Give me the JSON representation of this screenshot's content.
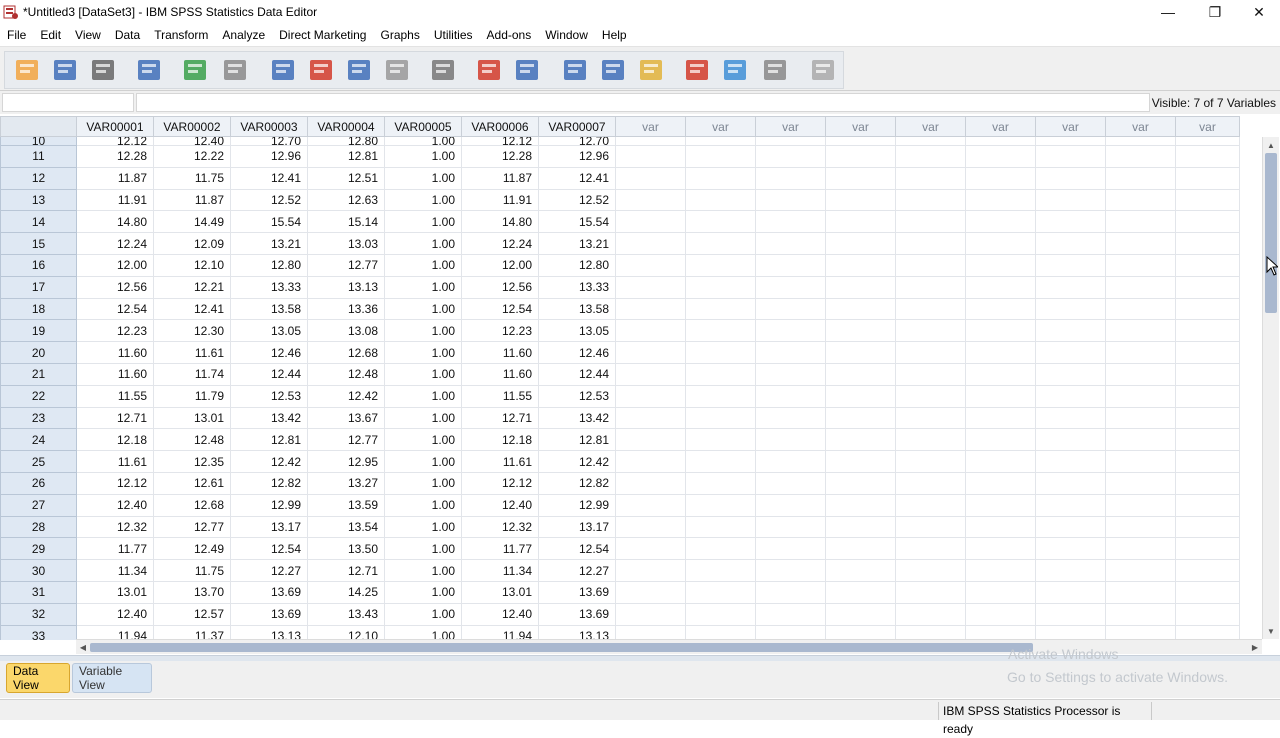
{
  "window": {
    "title": "*Untitled3 [DataSet3] - IBM SPSS Statistics Data Editor"
  },
  "menu": [
    "File",
    "Edit",
    "View",
    "Data",
    "Transform",
    "Analyze",
    "Direct Marketing",
    "Graphs",
    "Utilities",
    "Add-ons",
    "Window",
    "Help"
  ],
  "toolbar_icons": [
    "open-icon",
    "save-icon",
    "print-icon",
    "recall-dialog-icon",
    "undo-icon",
    "redo-icon",
    "goto-case-icon",
    "goto-variable-icon",
    "variables-icon",
    "find-icon",
    "binoculars-icon",
    "insert-cases-icon",
    "insert-variable-icon",
    "split-file-icon",
    "weight-cases-icon",
    "select-cases-icon",
    "value-labels-icon",
    "use-variable-sets-icon",
    "show-all-variables-icon",
    "spell-check-icon"
  ],
  "cellbar": {
    "visible": "Visible: 7 of 7 Variables"
  },
  "columns": [
    "VAR00001",
    "VAR00002",
    "VAR00003",
    "VAR00004",
    "VAR00005",
    "VAR00006",
    "VAR00007",
    "var",
    "var",
    "var",
    "var",
    "var",
    "var",
    "var",
    "var",
    "var"
  ],
  "rows": [
    {
      "n": "10",
      "v": [
        "12.12",
        "12.40",
        "12.70",
        "12.80",
        "1.00",
        "12.12",
        "12.70"
      ]
    },
    {
      "n": "11",
      "v": [
        "12.28",
        "12.22",
        "12.96",
        "12.81",
        "1.00",
        "12.28",
        "12.96"
      ]
    },
    {
      "n": "12",
      "v": [
        "11.87",
        "11.75",
        "12.41",
        "12.51",
        "1.00",
        "11.87",
        "12.41"
      ]
    },
    {
      "n": "13",
      "v": [
        "11.91",
        "11.87",
        "12.52",
        "12.63",
        "1.00",
        "11.91",
        "12.52"
      ]
    },
    {
      "n": "14",
      "v": [
        "14.80",
        "14.49",
        "15.54",
        "15.14",
        "1.00",
        "14.80",
        "15.54"
      ]
    },
    {
      "n": "15",
      "v": [
        "12.24",
        "12.09",
        "13.21",
        "13.03",
        "1.00",
        "12.24",
        "13.21"
      ]
    },
    {
      "n": "16",
      "v": [
        "12.00",
        "12.10",
        "12.80",
        "12.77",
        "1.00",
        "12.00",
        "12.80"
      ]
    },
    {
      "n": "17",
      "v": [
        "12.56",
        "12.21",
        "13.33",
        "13.13",
        "1.00",
        "12.56",
        "13.33"
      ]
    },
    {
      "n": "18",
      "v": [
        "12.54",
        "12.41",
        "13.58",
        "13.36",
        "1.00",
        "12.54",
        "13.58"
      ]
    },
    {
      "n": "19",
      "v": [
        "12.23",
        "12.30",
        "13.05",
        "13.08",
        "1.00",
        "12.23",
        "13.05"
      ]
    },
    {
      "n": "20",
      "v": [
        "11.60",
        "11.61",
        "12.46",
        "12.68",
        "1.00",
        "11.60",
        "12.46"
      ]
    },
    {
      "n": "21",
      "v": [
        "11.60",
        "11.74",
        "12.44",
        "12.48",
        "1.00",
        "11.60",
        "12.44"
      ]
    },
    {
      "n": "22",
      "v": [
        "11.55",
        "11.79",
        "12.53",
        "12.42",
        "1.00",
        "11.55",
        "12.53"
      ]
    },
    {
      "n": "23",
      "v": [
        "12.71",
        "13.01",
        "13.42",
        "13.67",
        "1.00",
        "12.71",
        "13.42"
      ]
    },
    {
      "n": "24",
      "v": [
        "12.18",
        "12.48",
        "12.81",
        "12.77",
        "1.00",
        "12.18",
        "12.81"
      ]
    },
    {
      "n": "25",
      "v": [
        "11.61",
        "12.35",
        "12.42",
        "12.95",
        "1.00",
        "11.61",
        "12.42"
      ]
    },
    {
      "n": "26",
      "v": [
        "12.12",
        "12.61",
        "12.82",
        "13.27",
        "1.00",
        "12.12",
        "12.82"
      ]
    },
    {
      "n": "27",
      "v": [
        "12.40",
        "12.68",
        "12.99",
        "13.59",
        "1.00",
        "12.40",
        "12.99"
      ]
    },
    {
      "n": "28",
      "v": [
        "12.32",
        "12.77",
        "13.17",
        "13.54",
        "1.00",
        "12.32",
        "13.17"
      ]
    },
    {
      "n": "29",
      "v": [
        "11.77",
        "12.49",
        "12.54",
        "13.50",
        "1.00",
        "11.77",
        "12.54"
      ]
    },
    {
      "n": "30",
      "v": [
        "11.34",
        "11.75",
        "12.27",
        "12.71",
        "1.00",
        "11.34",
        "12.27"
      ]
    },
    {
      "n": "31",
      "v": [
        "13.01",
        "13.70",
        "13.69",
        "14.25",
        "1.00",
        "13.01",
        "13.69"
      ]
    },
    {
      "n": "32",
      "v": [
        "12.40",
        "12.57",
        "13.69",
        "13.43",
        "1.00",
        "12.40",
        "13.69"
      ]
    },
    {
      "n": "33",
      "v": [
        "11.94",
        "11.37",
        "13.13",
        "12.10",
        "1.00",
        "11.94",
        "13.13"
      ]
    }
  ],
  "tabs": {
    "data_view": "Data View",
    "variable_view": "Variable View"
  },
  "watermark": {
    "line1": "Activate Windows",
    "line2": "Go to Settings to activate Windows."
  },
  "status": "IBM SPSS Statistics Processor is ready",
  "colors": {
    "active_tab": "#fbd76b",
    "row_header": "#dfe8f3",
    "scroll_thumb": "#a9b8cf"
  }
}
